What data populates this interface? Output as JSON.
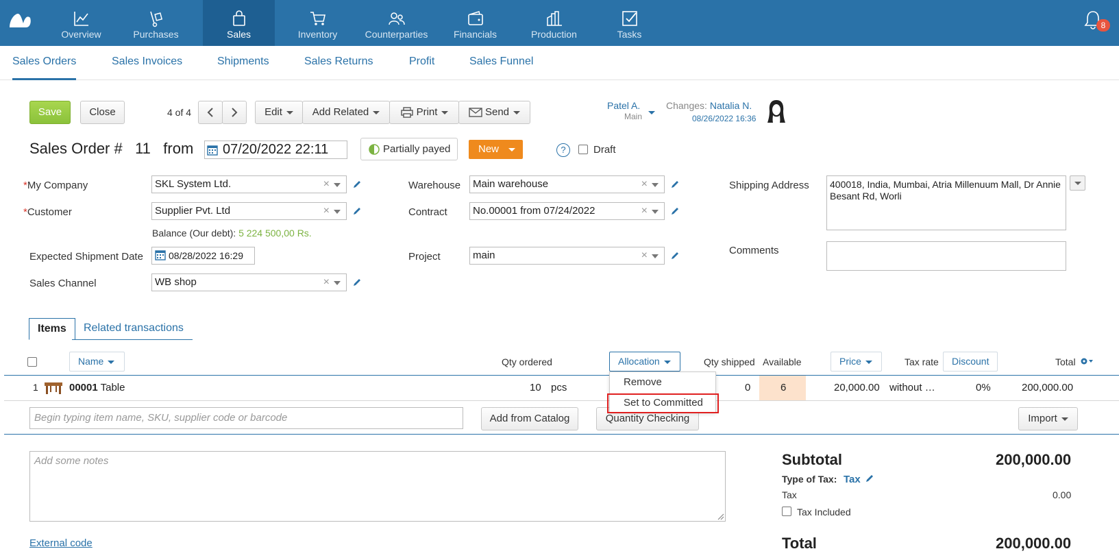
{
  "nav": {
    "items": [
      {
        "label": "Overview"
      },
      {
        "label": "Purchases"
      },
      {
        "label": "Sales"
      },
      {
        "label": "Inventory"
      },
      {
        "label": "Counterparties"
      },
      {
        "label": "Financials"
      },
      {
        "label": "Production"
      },
      {
        "label": "Tasks"
      }
    ],
    "active": "Sales",
    "notifications": "8"
  },
  "subnav": {
    "items": [
      "Sales Orders",
      "Sales Invoices",
      "Shipments",
      "Sales Returns",
      "Profit",
      "Sales Funnel"
    ],
    "active": "Sales Orders"
  },
  "toolbar": {
    "save": "Save",
    "close": "Close",
    "pager": "4 of 4",
    "edit": "Edit",
    "add_related": "Add Related",
    "print": "Print",
    "send": "Send"
  },
  "owner": {
    "name": "Patel A.",
    "sub": "Main"
  },
  "changes": {
    "label": "Changes:",
    "who": "Natalia N.",
    "date": "08/26/2022 16:36"
  },
  "order": {
    "title": "Sales Order #",
    "number": "11",
    "from": "from",
    "date": "07/20/2022 22:11",
    "payment_status": "Partially payed",
    "status": "New",
    "help": "?",
    "draft_label": "Draft"
  },
  "form": {
    "my_company_label": "My Company",
    "my_company": "SKL System Ltd.",
    "customer_label": "Customer",
    "customer": "Supplier Pvt. Ltd",
    "balance_label": "Balance (Our debt):",
    "balance_value": "5 224 500,00 Rs.",
    "ship_date_label": "Expected Shipment Date",
    "ship_date": "08/28/2022 16:29",
    "channel_label": "Sales Channel",
    "channel": "WB shop",
    "warehouse_label": "Warehouse",
    "warehouse": "Main warehouse",
    "contract_label": "Contract",
    "contract": "No.00001 from 07/24/2022",
    "project_label": "Project",
    "project": "main",
    "shipping_label": "Shipping Address",
    "shipping": "400018, India, Mumbai, Atria Millenuum Mall, Dr Annie Besant Rd, Worli",
    "comments_label": "Comments"
  },
  "tabs": {
    "items": "Items",
    "related": "Related transactions"
  },
  "table": {
    "headers": {
      "name": "Name",
      "qty_ordered": "Qty ordered",
      "allocation": "Allocation",
      "qty_shipped": "Qty shipped",
      "available": "Available",
      "price": "Price",
      "tax_rate": "Tax rate",
      "discount": "Discount",
      "total": "Total"
    },
    "rows": [
      {
        "num": "1",
        "sku": "00001",
        "name": "Table",
        "qty": "10",
        "unit": "pcs",
        "shipped": "0",
        "available": "6",
        "price": "20,000.00",
        "tax": "without …",
        "discount": "0%",
        "total": "200,000.00"
      }
    ]
  },
  "allocation_menu": [
    "Remove",
    "Set to Committed"
  ],
  "item_search": {
    "placeholder": "Begin typing item name, SKU, supplier code or barcode"
  },
  "actions": {
    "add_catalog": "Add from Catalog",
    "qty_check": "Quantity Checking",
    "import": "Import"
  },
  "notes": {
    "placeholder": "Add some notes"
  },
  "external_code": "External code",
  "totals": {
    "subtotal_label": "Subtotal",
    "subtotal": "200,000.00",
    "type_tax_label": "Type of Tax:",
    "type_tax": "Tax",
    "tax_label": "Tax",
    "tax": "0.00",
    "tax_included": "Tax Included",
    "total_label": "Total",
    "total": "200,000.00"
  }
}
